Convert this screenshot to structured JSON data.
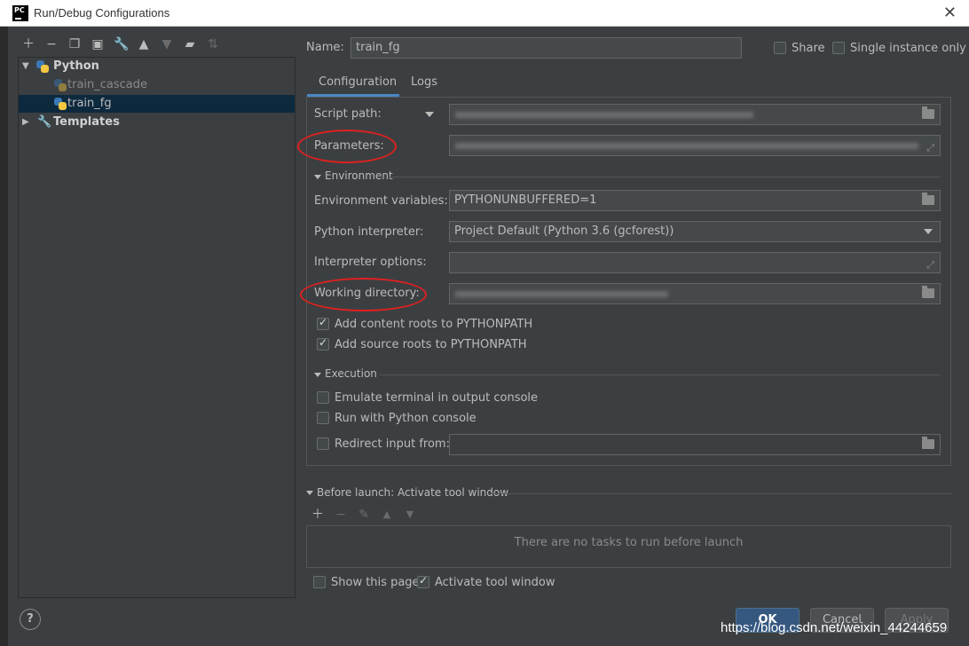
{
  "window": {
    "title": "Run/Debug Configurations",
    "logo": "PC"
  },
  "toolbar": {
    "icons": [
      "plus-icon",
      "minus-icon",
      "copy-icon",
      "save-icon",
      "wrench-icon",
      "arrow-up-icon",
      "arrow-down-icon",
      "folder-add-icon",
      "sort-icon"
    ]
  },
  "tree": {
    "python_group": "Python",
    "items": [
      "train_cascade",
      "train_fg"
    ],
    "templates": "Templates"
  },
  "header": {
    "name_label": "Name:",
    "name_value": "train_fg",
    "share_label": "Share",
    "single_instance_label": "Single instance only"
  },
  "tabs": [
    "Configuration",
    "Logs"
  ],
  "config": {
    "script_path_label": "Script path:",
    "parameters_label": "Parameters:",
    "environment_section": "Environment",
    "env_vars_label": "Environment variables:",
    "env_vars_value": "PYTHONUNBUFFERED=1",
    "interpreter_label": "Python interpreter:",
    "interpreter_value": "Project Default (Python 3.6 (gcforest))",
    "interpreter_options_label": "Interpreter options:",
    "working_dir_label": "Working directory:",
    "add_content_roots": "Add content roots to PYTHONPATH",
    "add_source_roots": "Add source roots to PYTHONPATH",
    "execution_section": "Execution",
    "emulate_terminal": "Emulate terminal in output console",
    "run_with_console": "Run with Python console",
    "redirect_input": "Redirect input from:"
  },
  "before_launch": {
    "title": "Before launch: Activate tool window",
    "empty_text": "There are no tasks to run before launch",
    "show_page": "Show this page",
    "activate_tool_window": "Activate tool window"
  },
  "buttons": {
    "help": "?",
    "ok": "OK",
    "cancel": "Cancel",
    "apply": "Apply"
  },
  "watermark": "https://blog.csdn.net/weixin_44244659",
  "colors": {
    "background": "#3c3f41",
    "selection": "#0d293e",
    "accent": "#4a88c7",
    "annotation": "#e02020"
  }
}
